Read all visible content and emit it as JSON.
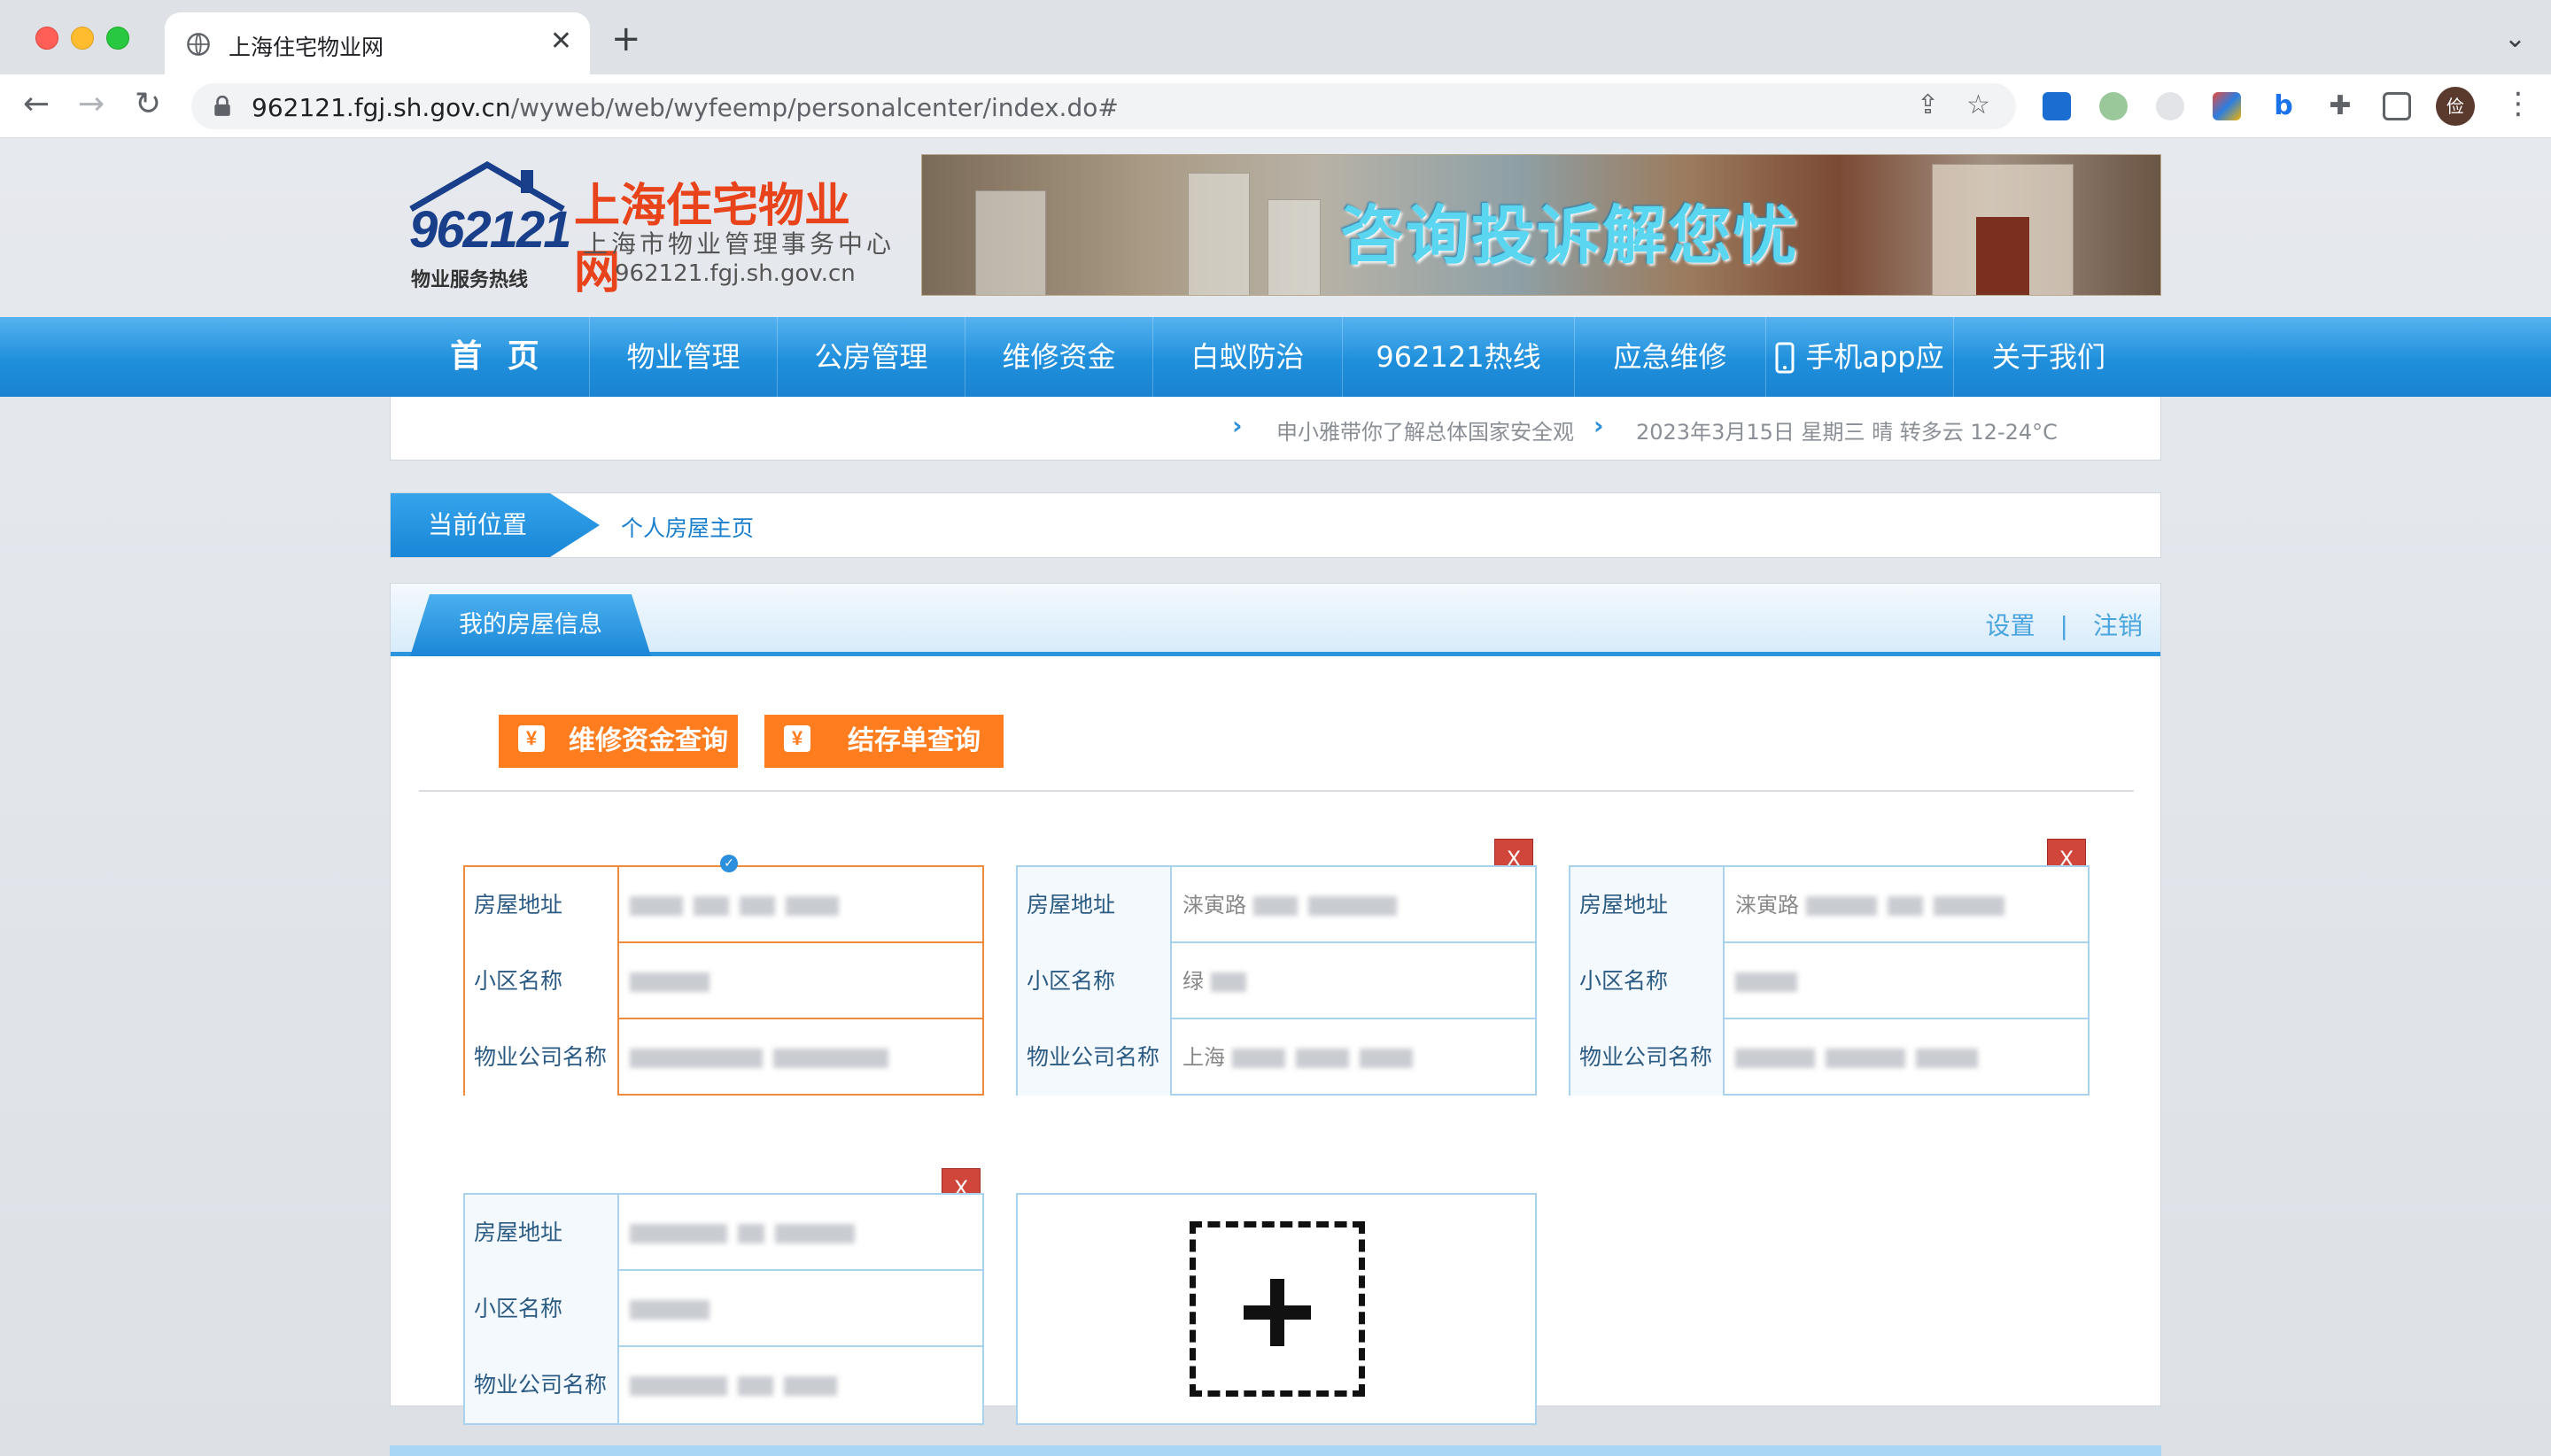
{
  "browser": {
    "tab_title": "上海住宅物业网",
    "url_host": "962121.fgj.sh.gov.cn",
    "url_path": "/wyweb/web/wyfeemp/personalcenter/index.do#",
    "profile_initial": "俭"
  },
  "header": {
    "logo_number": "962121",
    "logo_tagline": "物业服务热线",
    "logo_name": "上海住宅物业网",
    "logo_sub": "上海市物业管理事务中心",
    "logo_domain": "962121.fgj.sh.gov.cn",
    "banner_slogan": "咨询投诉解您忧"
  },
  "nav": {
    "items": [
      "首 页",
      "物业管理",
      "公房管理",
      "维修资金",
      "白蚁防治",
      "962121热线",
      "应急维修",
      "手机app应用",
      "关于我们"
    ]
  },
  "ticker": {
    "news": "申小雅带你了解总体国家安全观",
    "weather": "2023年3月15日 星期三  晴 转多云   12-24°C"
  },
  "breadcrumb": {
    "label": "当前位置",
    "current": "个人房屋主页"
  },
  "panel": {
    "title": "我的房屋信息",
    "settings": "设置",
    "separator": "|",
    "logout": "注销",
    "btn_fund_query": "维修资金查询",
    "btn_deposit_query": "结存单查询",
    "yen_symbol": "¥",
    "close_symbol": "X",
    "check_symbol": "✓"
  },
  "cards": {
    "labels": {
      "address": "房屋地址",
      "community": "小区名称",
      "company": "物业公司名称"
    },
    "card2": {
      "address_prefix": "涞寅路",
      "community_prefix": "绿",
      "company_prefix": "上海"
    },
    "card3": {
      "address_prefix": "涞寅路",
      "community_prefix": "",
      "company_prefix": ""
    }
  },
  "colors": {
    "nav_blue": "#1f8fdc",
    "accent_orange": "#ff7d1e",
    "active_border": "#f08a3c",
    "card_border": "#a9d2ee",
    "close_red": "#d0463a"
  }
}
